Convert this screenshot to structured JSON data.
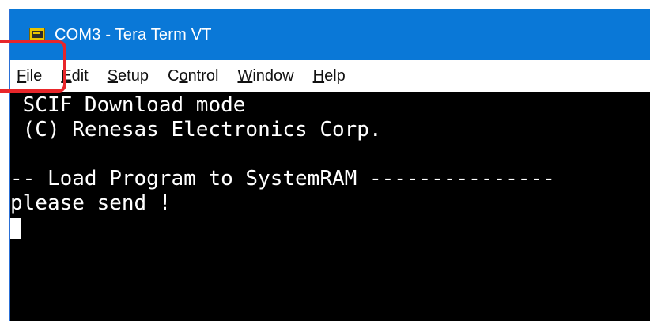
{
  "window": {
    "title": "COM3 - Tera Term VT",
    "icon": "tera-term-vt-icon"
  },
  "menubar": {
    "items": [
      {
        "label_underlined": "F",
        "label_rest": "ile"
      },
      {
        "label_underlined": "E",
        "label_rest": "dit"
      },
      {
        "label_underlined": "S",
        "label_rest": "etup"
      },
      {
        "label_prefix": "C",
        "label_underlined": "o",
        "label_rest": "ntrol"
      },
      {
        "label_underlined": "W",
        "label_rest": "indow"
      },
      {
        "label_underlined": "H",
        "label_rest": "elp"
      }
    ]
  },
  "highlight": {
    "color": "#e8262a",
    "target": "File"
  },
  "terminal": {
    "lines": [
      " SCIF Download mode",
      " (C) Renesas Electronics Corp.",
      "",
      "-- Load Program to SystemRAM ---------------",
      "please send !"
    ]
  },
  "colors": {
    "titlebar": "#0a78d7",
    "terminal_bg": "#000000",
    "terminal_fg": "#ffffff"
  }
}
